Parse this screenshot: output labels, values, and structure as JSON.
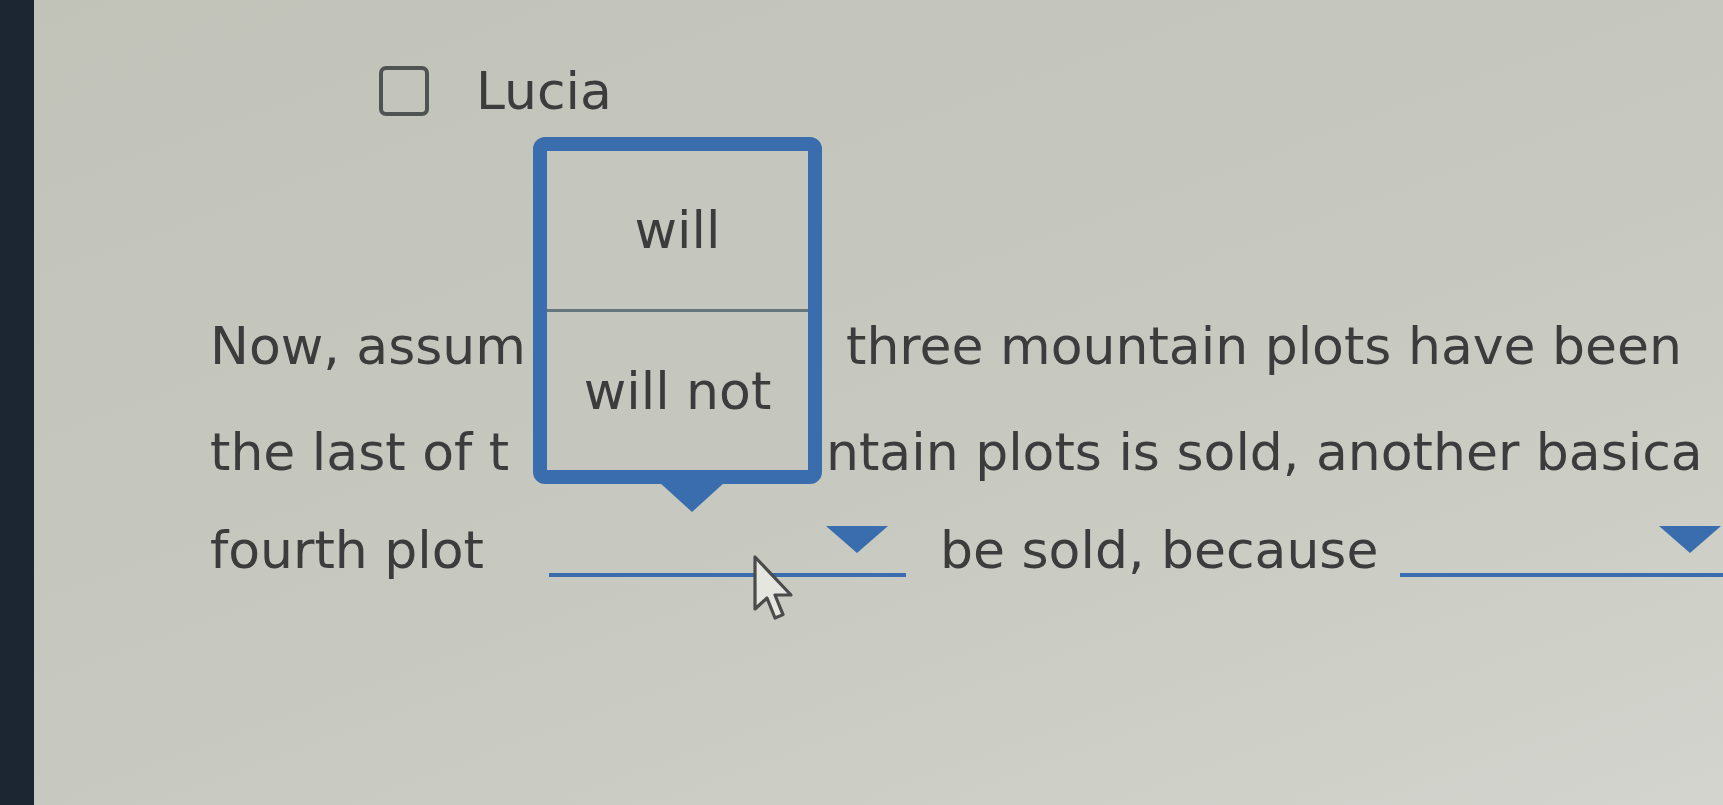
{
  "choices": [
    {
      "label": "Lucia",
      "checked": false
    }
  ],
  "question": {
    "lines": [
      {
        "segments": [
          {
            "kind": "text",
            "text": "Now, assum"
          },
          {
            "kind": "text",
            "text": "three mountain plots have been"
          }
        ]
      },
      {
        "segments": [
          {
            "kind": "text",
            "text": "the last of t"
          },
          {
            "kind": "text",
            "text": "ntain plots is sold, another basica"
          }
        ]
      },
      {
        "segments": [
          {
            "kind": "text",
            "text": "fourth plot"
          },
          {
            "kind": "dropdown",
            "expanded": true,
            "options": [
              {
                "label": "will",
                "selected": false
              },
              {
                "label": "will not",
                "selected": false
              }
            ]
          },
          {
            "kind": "text",
            "text": "be sold, because"
          },
          {
            "kind": "dropdown",
            "expanded": false
          }
        ]
      }
    ]
  }
}
